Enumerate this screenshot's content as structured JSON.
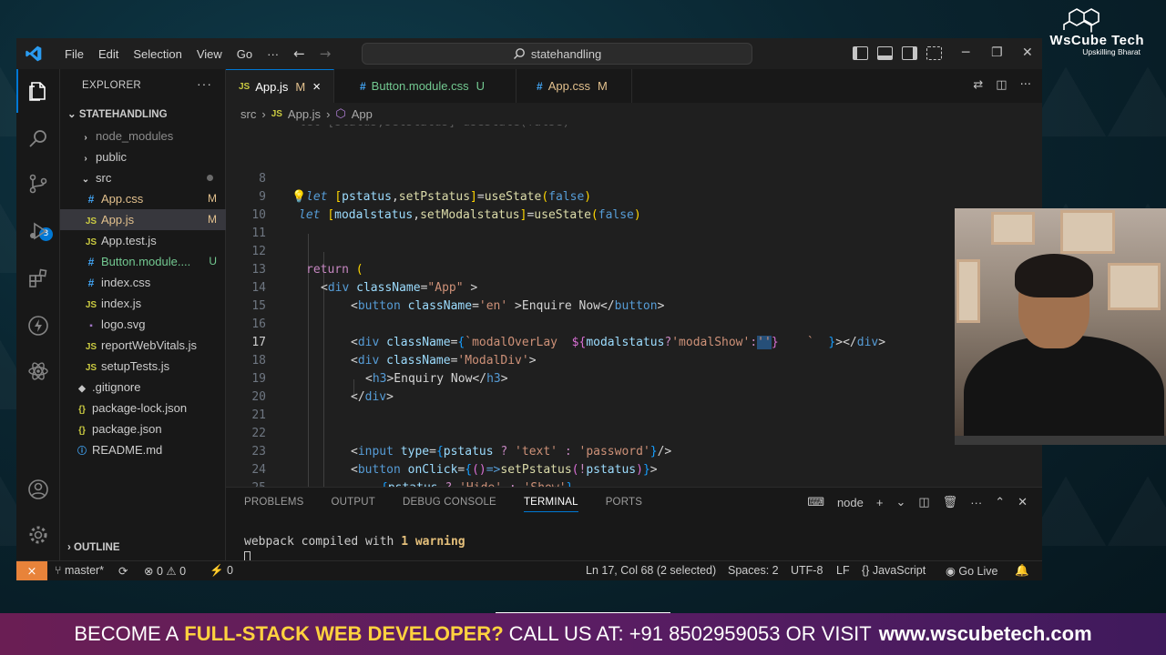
{
  "window": {
    "menu": [
      "File",
      "Edit",
      "Selection",
      "View",
      "Go"
    ],
    "menu_more": "···",
    "search_text": "statehandling"
  },
  "explorer": {
    "title": "EXPLORER",
    "more": "···",
    "root": "STATEHANDLING",
    "items": [
      {
        "label": "node_modules",
        "type": "folder-closed",
        "status": ""
      },
      {
        "label": "public",
        "type": "folder-closed",
        "status": ""
      },
      {
        "label": "src",
        "type": "folder-open",
        "status": ""
      },
      {
        "label": "App.css",
        "type": "css",
        "status": "M"
      },
      {
        "label": "App.js",
        "type": "js",
        "status": "M"
      },
      {
        "label": "App.test.js",
        "type": "js",
        "status": ""
      },
      {
        "label": "Button.module....",
        "type": "css",
        "status": "U"
      },
      {
        "label": "index.css",
        "type": "css",
        "status": ""
      },
      {
        "label": "index.js",
        "type": "js",
        "status": ""
      },
      {
        "label": "logo.svg",
        "type": "svg",
        "status": ""
      },
      {
        "label": "reportWebVitals.js",
        "type": "js",
        "status": ""
      },
      {
        "label": "setupTests.js",
        "type": "js",
        "status": ""
      },
      {
        "label": ".gitignore",
        "type": "git",
        "status": ""
      },
      {
        "label": "package-lock.json",
        "type": "json",
        "status": ""
      },
      {
        "label": "package.json",
        "type": "json",
        "status": ""
      },
      {
        "label": "README.md",
        "type": "md",
        "status": ""
      }
    ],
    "outline": "OUTLINE",
    "scm_badge": "3"
  },
  "tabs": [
    {
      "icon": "JS",
      "label": "App.js",
      "mark": "M",
      "close": "×"
    },
    {
      "icon": "#",
      "label": "Button.module.css",
      "mark": "U",
      "close": ""
    },
    {
      "icon": "#",
      "label": "App.css",
      "mark": "M",
      "close": ""
    }
  ],
  "breadcrumb": {
    "folder": "src",
    "sep": "›",
    "file": "App.js",
    "symbol": "App"
  },
  "editor": {
    "line_numbers": [
      "8",
      "9",
      "10",
      "11",
      "12",
      "13",
      "14",
      "15",
      "16",
      "17",
      "18",
      "19",
      "20",
      "21",
      "22",
      "23",
      "24",
      "25",
      "26"
    ],
    "partial_line_top": "let [status,setstatus]=useState(false)"
  },
  "panel": {
    "tabs": [
      "PROBLEMS",
      "OUTPUT",
      "DEBUG CONSOLE",
      "TERMINAL",
      "PORTS"
    ],
    "terminal_name": "node",
    "terminal_prefix": "webpack compiled with ",
    "terminal_warn": "1 warning"
  },
  "status": {
    "branch": "master*",
    "errors": "0",
    "warnings": "0",
    "ports": "0",
    "position": "Ln 17, Col 68 (2 selected)",
    "spaces": "Spaces: 2",
    "encoding": "UTF-8",
    "eol": "LF",
    "language": "JavaScript",
    "golive": "Go Live"
  },
  "brand": {
    "name": "WsCube Tech",
    "tagline": "Upskilling Bharat"
  },
  "banner": {
    "part1": "BECOME A",
    "highlight": "FULL-STACK WEB DEVELOPER?",
    "part2": "CALL US AT: +91 8502959053 OR VISIT",
    "url": "www.wscubetech.com"
  },
  "colors": {
    "accent": "#0078d4",
    "remote": "#e8833a",
    "banner_highlight": "#ffd23f"
  }
}
